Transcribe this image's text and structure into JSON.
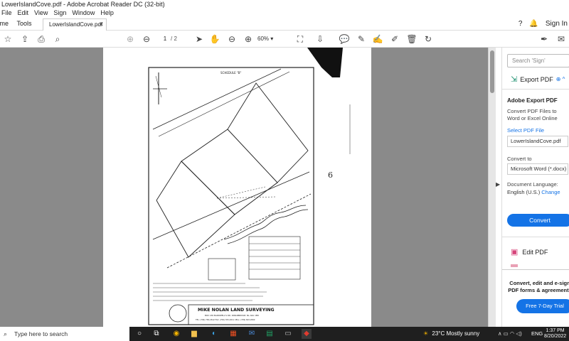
{
  "window": {
    "title": "LowerIslandCove.pdf - Adobe Acrobat Reader DC (32-bit)",
    "controls": [
      "–",
      "□",
      "✕"
    ]
  },
  "menu": [
    "File",
    "Edit",
    "View",
    "Sign",
    "Window",
    "Help"
  ],
  "tabs": {
    "home": "Home",
    "tools": "Tools",
    "document": "LowerIslandCove.pdf",
    "close": "×",
    "sign_in": "Sign In"
  },
  "toolbar": {
    "current_page": "1",
    "page_sep": "/",
    "page_count": "2",
    "zoom": "60%"
  },
  "right_pane": {
    "search_placeholder": "Search 'Sign'",
    "export_label": "Export PDF",
    "panel_title": "Adobe Export PDF",
    "panel_desc": "Convert PDF Files to Word or Excel Online",
    "select_file": "Select PDF File",
    "file_name": "LowerIslandCove.pdf",
    "convert_to_label": "Convert to",
    "format": "Microsoft Word (*.docx)",
    "doc_lang_label": "Document Language:",
    "lang": "English (U.S.)",
    "change": "Change",
    "convert_button": "Convert",
    "edit_label": "Edit PDF",
    "promo": "Convert, edit and e-sign PDF forms & agreements",
    "trial_button": "Free 7-Day Trial"
  },
  "taskbar": {
    "search_placeholder": "Type here to search",
    "weather_temp": "23°C",
    "weather_desc": "Mostly sunny",
    "lang": "ENG",
    "time": "1:37 PM",
    "date": "8/20/2022"
  },
  "document": {
    "schedule": "SCHEDULE \"B\"",
    "company": "MIKE NOLAN LAND SURVEYING",
    "address": "BOX 136 BARDWELL'S RD, KINGSBRIDGE, NL A0A 1M0",
    "phone": "TEL: (709) 765-2612   FAX: (709) 765-2611   CELL: (709) 693-2060",
    "margin_mark": "6"
  }
}
